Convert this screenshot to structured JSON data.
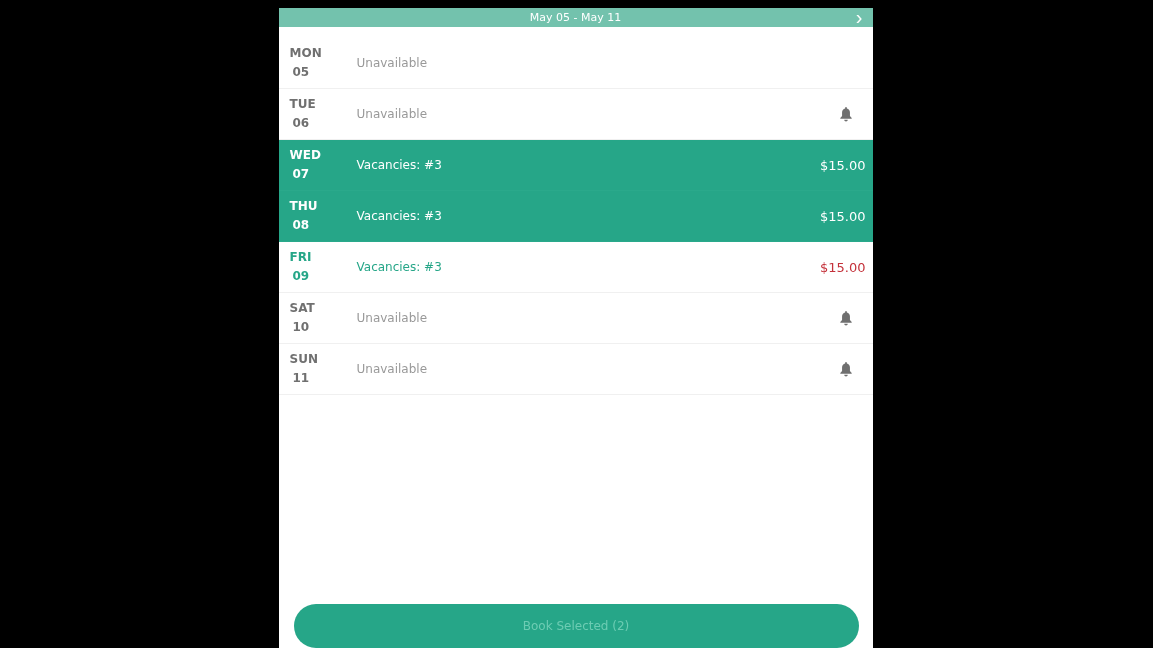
{
  "header": {
    "title": "May 05 - May 11",
    "next": "›"
  },
  "days": [
    {
      "day": "MON",
      "date": "05",
      "status": "Unavailable",
      "kind": "unavailable",
      "bell": false,
      "selected": false
    },
    {
      "day": "TUE",
      "date": "06",
      "status": "Unavailable",
      "kind": "unavailable",
      "bell": true,
      "selected": false
    },
    {
      "day": "WED",
      "date": "07",
      "status": "Vacancies: #3",
      "kind": "available",
      "price": "$15.00",
      "bell": false,
      "selected": true
    },
    {
      "day": "THU",
      "date": "08",
      "status": "Vacancies: #3",
      "kind": "available",
      "price": "$15.00",
      "bell": false,
      "selected": true
    },
    {
      "day": "FRI",
      "date": "09",
      "status": "Vacancies: #3",
      "kind": "available",
      "price": "$15.00",
      "bell": false,
      "selected": false
    },
    {
      "day": "SAT",
      "date": "10",
      "status": "Unavailable",
      "kind": "unavailable",
      "bell": true,
      "selected": false
    },
    {
      "day": "SUN",
      "date": "11",
      "status": "Unavailable",
      "kind": "unavailable",
      "bell": true,
      "selected": false
    }
  ],
  "book_button": {
    "label": "Book Selected (2)"
  }
}
